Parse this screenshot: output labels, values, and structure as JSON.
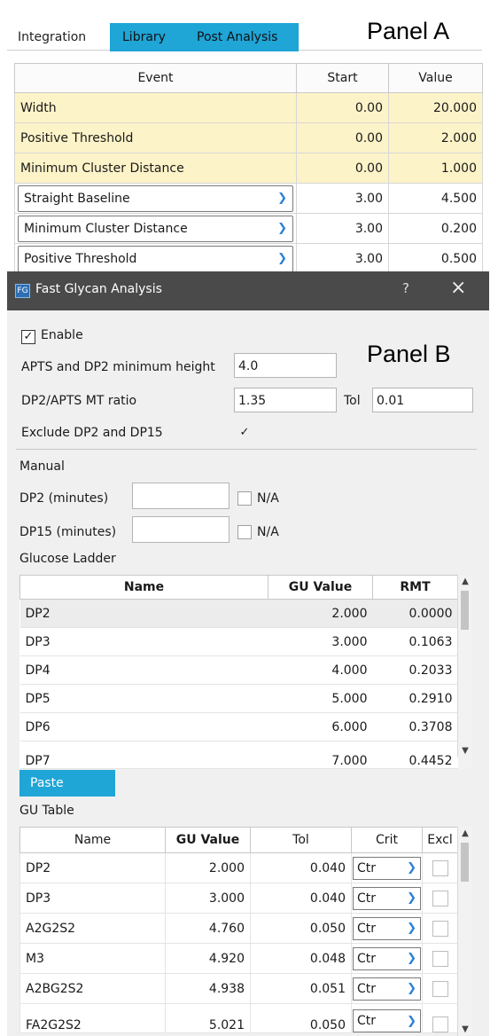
{
  "panel_a": {
    "label": "Panel A",
    "tabs": [
      "Integration",
      "Library",
      "Post Analysis"
    ],
    "table": {
      "headers": [
        "Event",
        "Start",
        "Value"
      ],
      "rows": [
        {
          "event": "Width",
          "start": "0.00",
          "value": "20.000"
        },
        {
          "event": "Positive Threshold",
          "start": "0.00",
          "value": "2.000"
        },
        {
          "event": "Minimum Cluster Distance",
          "start": "0.00",
          "value": "1.000"
        },
        {
          "event": "Straight Baseline",
          "start": "3.00",
          "value": "4.500"
        },
        {
          "event": "Minimum Cluster Distance",
          "start": "3.00",
          "value": "0.200"
        },
        {
          "event": "Positive Threshold",
          "start": "3.00",
          "value": "0.500"
        }
      ]
    }
  },
  "dialog": {
    "icon_text": "FG",
    "title": "Fast Glycan Analysis",
    "help": "?",
    "close": "×",
    "panel_label": "Panel B",
    "enable_label": "Enable",
    "apts_label": "APTS and DP2 minimum height",
    "apts_value": "4.0",
    "ratio_label": "DP2/APTS MT ratio",
    "ratio_value": "1.35",
    "tol_label": "Tol",
    "tol_value": "0.01",
    "exclude_label": "Exclude DP2 and DP15",
    "manual_label": "Manual",
    "dp2_label": "DP2 (minutes)",
    "dp15_label": "DP15 (minutes)",
    "na_label": "N/A",
    "glucose_label": "Glucose Ladder",
    "ladder": {
      "headers": [
        "Name",
        "GU Value",
        "RMT"
      ],
      "rows": [
        {
          "name": "DP2",
          "gu": "2.000",
          "rmt": "0.0000"
        },
        {
          "name": "DP3",
          "gu": "3.000",
          "rmt": "0.1063"
        },
        {
          "name": "DP4",
          "gu": "4.000",
          "rmt": "0.2033"
        },
        {
          "name": "DP5",
          "gu": "5.000",
          "rmt": "0.2910"
        },
        {
          "name": "DP6",
          "gu": "6.000",
          "rmt": "0.3708"
        },
        {
          "name": "DP7",
          "gu": "7.000",
          "rmt": "0.4452"
        }
      ]
    },
    "paste_label": "Paste",
    "gu_table_label": "GU Table",
    "gu_table": {
      "headers": [
        "Name",
        "GU Value",
        "Tol",
        "Crit",
        "Excl"
      ],
      "rows": [
        {
          "name": "DP2",
          "gu": "2.000",
          "tol": "0.040",
          "crit": "Ctr"
        },
        {
          "name": "DP3",
          "gu": "3.000",
          "tol": "0.040",
          "crit": "Ctr"
        },
        {
          "name": "A2G2S2",
          "gu": "4.760",
          "tol": "0.050",
          "crit": "Ctr"
        },
        {
          "name": "M3",
          "gu": "4.920",
          "tol": "0.048",
          "crit": "Ctr"
        },
        {
          "name": "A2BG2S2",
          "gu": "4.938",
          "tol": "0.051",
          "crit": "Ctr"
        },
        {
          "name": "FA2G2S2",
          "gu": "5.021",
          "tol": "0.050",
          "crit": "Ctr"
        }
      ]
    }
  },
  "colors": {
    "accent": "#1fa5d6",
    "highlight_row": "#fdf3c8",
    "title_bar": "#4a4a4a"
  }
}
